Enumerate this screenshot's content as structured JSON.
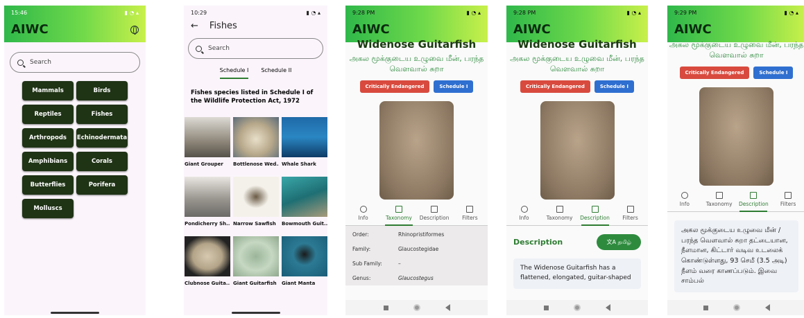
{
  "phone1": {
    "status_time": "15:46",
    "app_title": "AIWC",
    "search_placeholder": "Search",
    "categories": [
      "Mammals",
      "Birds",
      "Reptiles",
      "Fishes",
      "Arthropods",
      "Echinodermata",
      "Amphibians",
      "Corals",
      "Butterflies",
      "Porifera",
      "Molluscs"
    ]
  },
  "phone2": {
    "status_time": "10:29",
    "title": "Fishes",
    "search_placeholder": "Search",
    "tabs": [
      "Schedule I",
      "Schedule II"
    ],
    "heading": "Fishes species listed in Schedule I of the Wildlife Protection Act, 1972",
    "fishes": [
      "Giant Grouper",
      "Bottlenose Wed...",
      "Whale Shark",
      "Pondicherry Sh...",
      "Narrow Sawfish",
      "Bowmouth Guit...",
      "Clubnose Guita...",
      "Giant Guitarfish",
      "Giant Manta"
    ]
  },
  "species": {
    "status_time": "9:28 PM",
    "status_time_5": "9:29 PM",
    "app_title": "AIWC",
    "name": "Widenose Guitarfish",
    "tamil_name": "அகல மூக்குடைய உழுவை மீன், பரந்த வெளவால் சுறா",
    "status_badge": "Critically Endangered",
    "schedule_badge": "Schedule I",
    "tabs": [
      "Info",
      "Taxonomy",
      "Description",
      "Filters"
    ],
    "taxonomy": [
      {
        "key": "Order:",
        "value": "Rhinopristiformes"
      },
      {
        "key": "Family:",
        "value": "Glaucostegidae"
      },
      {
        "key": "Sub Family:",
        "value": "–"
      },
      {
        "key": "Genus:",
        "value": "Glaucostegus"
      }
    ],
    "description_heading": "Description",
    "translate_button": "தமிழ்",
    "description_en": "The Widenose Guitarfish has a flattened, elongated, guitar-shaped",
    "description_ta": "அகல மூக்குடைய உழுவை மீன் / பரந்த வெளவால் சுறா தட்டையான, நீளமான, கிட்டார் வடிவ உடலைக் கொண்டுள்ளது, 93 செமீ (3.5 அடி) நீளம் வரை காணப்படும். இவை சாம்பல்"
  },
  "colors": {
    "accent": "#2e7d32",
    "category_bg": "#1f3315",
    "critical": "#d94a3e",
    "schedule": "#2f6fd0"
  }
}
